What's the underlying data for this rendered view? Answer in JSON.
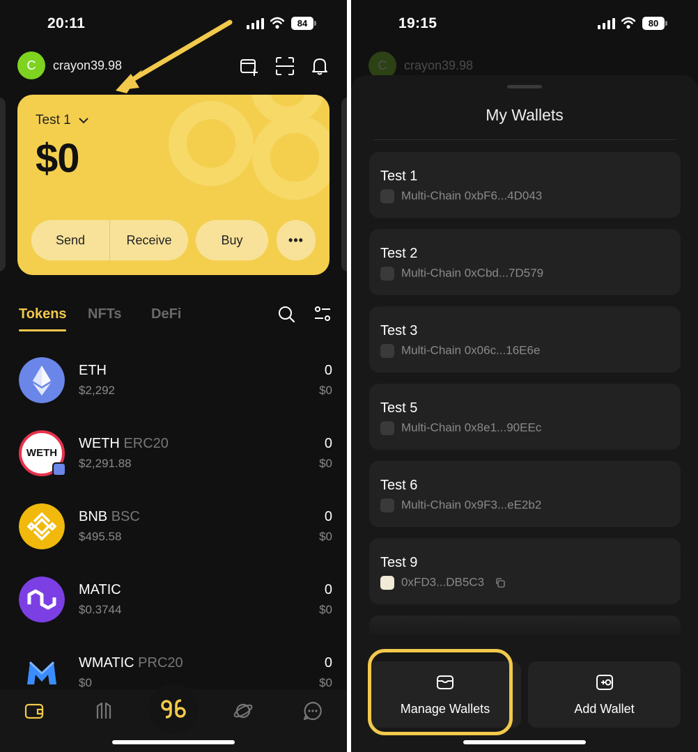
{
  "left": {
    "status": {
      "time": "20:11",
      "battery": "84"
    },
    "header": {
      "avatar_letter": "C",
      "username": "crayon39.98"
    },
    "card": {
      "wallet_name": "Test 1",
      "balance": "$0",
      "send_label": "Send",
      "receive_label": "Receive",
      "buy_label": "Buy",
      "more_label": "•••"
    },
    "tabs": [
      {
        "label": "Tokens",
        "active": true
      },
      {
        "label": "NFTs",
        "active": false
      },
      {
        "label": "DeFi",
        "active": false
      }
    ],
    "tokens": [
      {
        "symbol": "ETH",
        "chain": "",
        "price": "$2,292",
        "amount": "0",
        "value": "$0",
        "logo_text": "",
        "icon": "eth-icon"
      },
      {
        "symbol": "WETH",
        "chain": "ERC20",
        "price": "$2,291.88",
        "amount": "0",
        "value": "$0",
        "logo_text": "WETH",
        "icon": "weth-icon"
      },
      {
        "symbol": "BNB",
        "chain": "BSC",
        "price": "$495.58",
        "amount": "0",
        "value": "$0",
        "logo_text": "",
        "icon": "bnb-icon"
      },
      {
        "symbol": "MATIC",
        "chain": "",
        "price": "$0.3744",
        "amount": "0",
        "value": "$0",
        "logo_text": "",
        "icon": "matic-icon"
      },
      {
        "symbol": "WMATIC",
        "chain": "PRC20",
        "price": "$0",
        "amount": "0",
        "value": "$0",
        "logo_text": "",
        "icon": "wmatic-icon"
      }
    ],
    "nav": [
      "wallet-icon",
      "bridge-icon",
      "brand-logo-icon",
      "planet-icon",
      "chat-icon"
    ]
  },
  "right": {
    "status": {
      "time": "19:15",
      "battery": "80"
    },
    "header": {
      "avatar_letter": "C",
      "username": "crayon39.98"
    },
    "sheet_title": "My Wallets",
    "wallets": [
      {
        "name": "Test 1",
        "chain": "Multi-Chain",
        "address": "0xbF6...4D043",
        "icon": "multichain-icon"
      },
      {
        "name": "Test 2",
        "chain": "Multi-Chain",
        "address": "0xCbd...7D579",
        "icon": "multichain-icon"
      },
      {
        "name": "Test 3",
        "chain": "Multi-Chain",
        "address": "0x06c...16E6e",
        "icon": "multichain-icon"
      },
      {
        "name": "Test 5",
        "chain": "Multi-Chain",
        "address": "0x8e1...90EEc",
        "icon": "multichain-icon"
      },
      {
        "name": "Test 6",
        "chain": "Multi-Chain",
        "address": "0x9F3...eE2b2",
        "icon": "multichain-icon"
      },
      {
        "name": "Test 9",
        "chain": "",
        "address": "0xFD3...DB5C3",
        "icon": "single-chain-icon"
      }
    ],
    "manage_label": "Manage Wallets",
    "add_label": "Add Wallet"
  },
  "colors": {
    "accent": "#f2c94c",
    "card": "#f4cf4e",
    "background": "#111111",
    "avatar": "#7ed321"
  }
}
